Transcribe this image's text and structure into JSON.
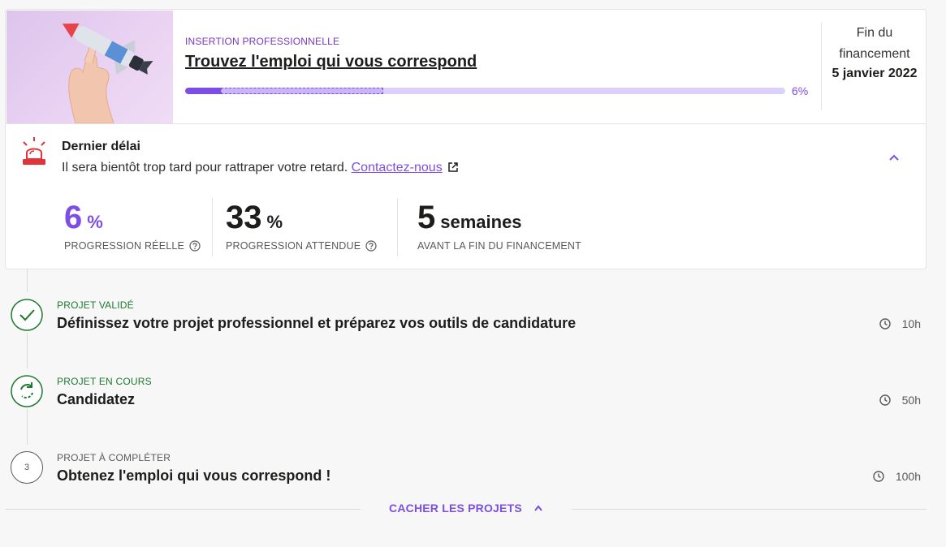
{
  "course": {
    "category": "INSERTION PROFESSIONNELLE",
    "title": "Trouvez l'emploi qui vous correspond",
    "progress_fraction": 0.06,
    "expected_fraction": 0.33,
    "progress_label": "6%"
  },
  "funding": {
    "label": "Fin du financement",
    "date": "5 janvier 2022"
  },
  "alert": {
    "title": "Dernier délai",
    "text": "Il sera bientôt trop tard pour rattraper votre retard.",
    "link": "Contactez-nous"
  },
  "stats": [
    {
      "value": "6",
      "unit": "%",
      "label": "PROGRESSION RÉELLE"
    },
    {
      "value": "33",
      "unit": "%",
      "label": "PROGRESSION ATTENDUE"
    },
    {
      "value": "5",
      "unit": "semaines",
      "label": "AVANT LA FIN DU FINANCEMENT"
    }
  ],
  "projects": [
    {
      "status": "PROJET VALIDÉ",
      "title": "Définissez votre projet professionnel et préparez vos outils de candidature",
      "duration": "10h",
      "state": "done"
    },
    {
      "status": "PROJET EN COURS",
      "title": "Candidatez",
      "duration": "50h",
      "state": "in-progress"
    },
    {
      "status": "PROJET À COMPLÉTER",
      "title": "Obtenez l'emploi qui vous correspond !",
      "duration": "100h",
      "state": "todo",
      "number": "3"
    }
  ],
  "footer": {
    "hide_projects": "CACHER LES PROJETS"
  },
  "colors": {
    "accent": "#7c4ee4",
    "category": "#7a37c4",
    "success": "#1d7a2f",
    "alarm": "#e0333a"
  }
}
